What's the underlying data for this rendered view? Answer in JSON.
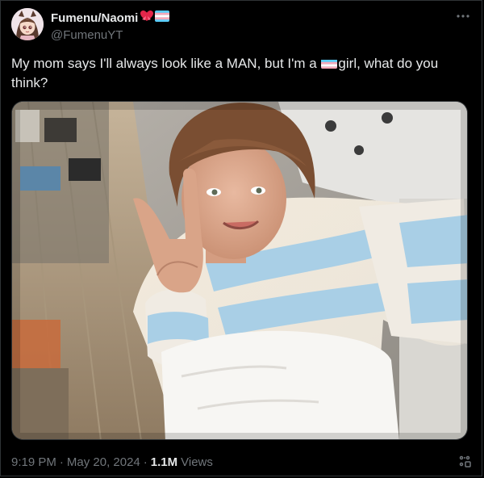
{
  "tweet": {
    "display_name": "Fumenu/Naomi",
    "handle": "@FumenuYT",
    "text_before_flag": "My mom says I'll always look like a MAN, but I'm a ",
    "text_after_flag": "girl, what do you think?",
    "time": "9:19 PM",
    "date": "May 20, 2024",
    "views_count": "1.1M",
    "views_label": "Views",
    "separator": "·"
  },
  "icons": {
    "more": "more-icon",
    "analytics": "analytics-icon",
    "flag": "trans-flag-emoji",
    "heart": "heart-ribbon-emoji"
  },
  "colors": {
    "background": "#000000",
    "text_primary": "#e7e9ea",
    "text_secondary": "#71767b",
    "border": "#2f3336",
    "flag_blue": "#5bcefa",
    "flag_pink": "#f5a9b8",
    "flag_white": "#ffffff"
  }
}
